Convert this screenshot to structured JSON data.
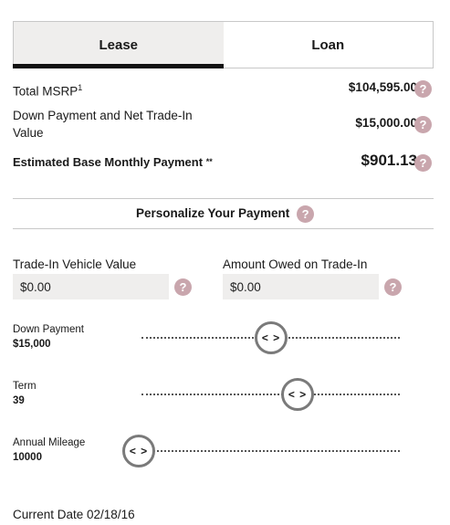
{
  "tabs": [
    {
      "label": "Lease",
      "active": true
    },
    {
      "label": "Loan",
      "active": false
    }
  ],
  "summary": {
    "msrp_label": "Total MSRP",
    "msrp_sup": "1",
    "msrp_value": "$104,595.00",
    "down_label": "Down Payment and Net Trade-In Value",
    "down_value": "$15,000.00",
    "monthly_label": "Estimated Base Monthly Payment",
    "monthly_marker": "**",
    "monthly_value": "$901.13"
  },
  "help_icon_glyph": "?",
  "personalize": {
    "title": "Personalize Your Payment"
  },
  "trade_in": {
    "label": "Trade-In Vehicle Value",
    "value": "$0.00"
  },
  "amount_owed": {
    "label": "Amount Owed on Trade-In",
    "value": "$0.00"
  },
  "sliders": [
    {
      "label": "Down Payment",
      "value": "$15,000",
      "level": 0.5
    },
    {
      "label": "Term",
      "value": "39",
      "level": 0.6
    },
    {
      "label": "Annual Mileage",
      "value": "10000",
      "level": 0.0
    }
  ],
  "knob_glyph": "< >",
  "footer": {
    "current_date": "Current Date 02/18/16"
  },
  "colors": {
    "help_icon": "#c9a6ad",
    "tab_active_bg": "#efeeed",
    "tab_indicator": "#111111"
  }
}
